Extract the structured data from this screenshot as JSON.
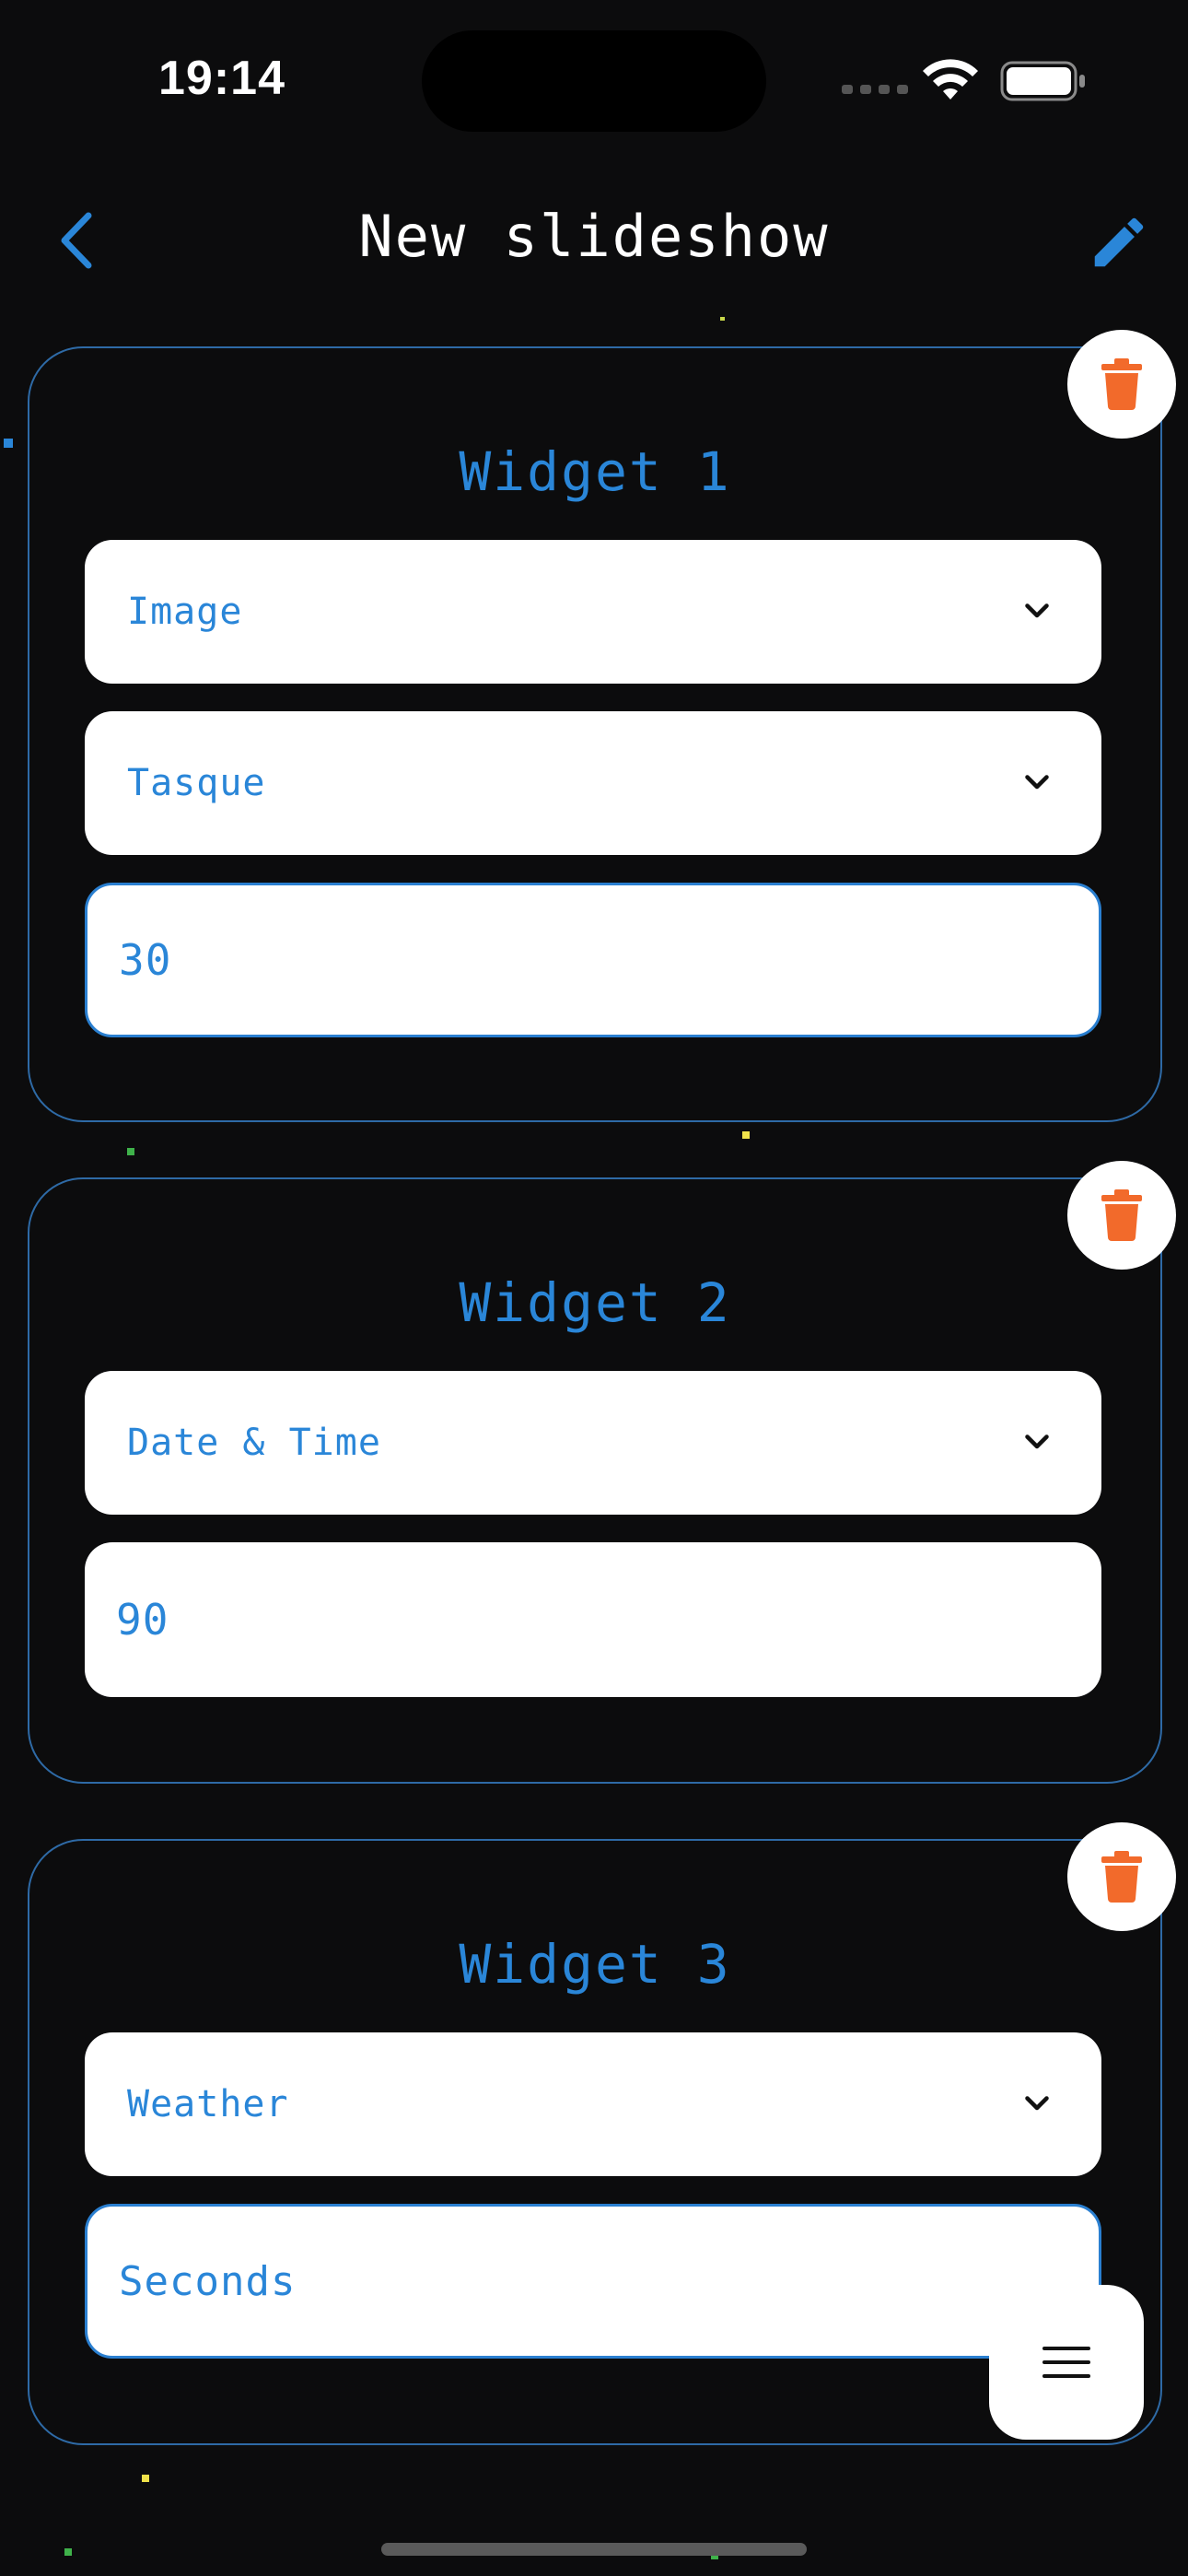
{
  "status": {
    "time": "19:14"
  },
  "nav": {
    "title": "New slideshow"
  },
  "widgets": [
    {
      "title": "Widget 1",
      "type": "Image",
      "source": "Tasque",
      "duration": "30"
    },
    {
      "title": "Widget 2",
      "type": "Date & Time",
      "duration": "90"
    },
    {
      "title": "Widget 3",
      "type": "Weather",
      "duration_placeholder": "Seconds"
    }
  ],
  "colors": {
    "accent": "#2a86d8",
    "delete": "#f26a2b",
    "background": "#0c0c0d",
    "card_border": "#2e6aa6"
  },
  "icons": {
    "back": "chevron-left-icon",
    "edit": "pencil-icon",
    "delete": "trash-icon",
    "menu": "hamburger-icon",
    "dropdown": "chevron-down-icon"
  }
}
